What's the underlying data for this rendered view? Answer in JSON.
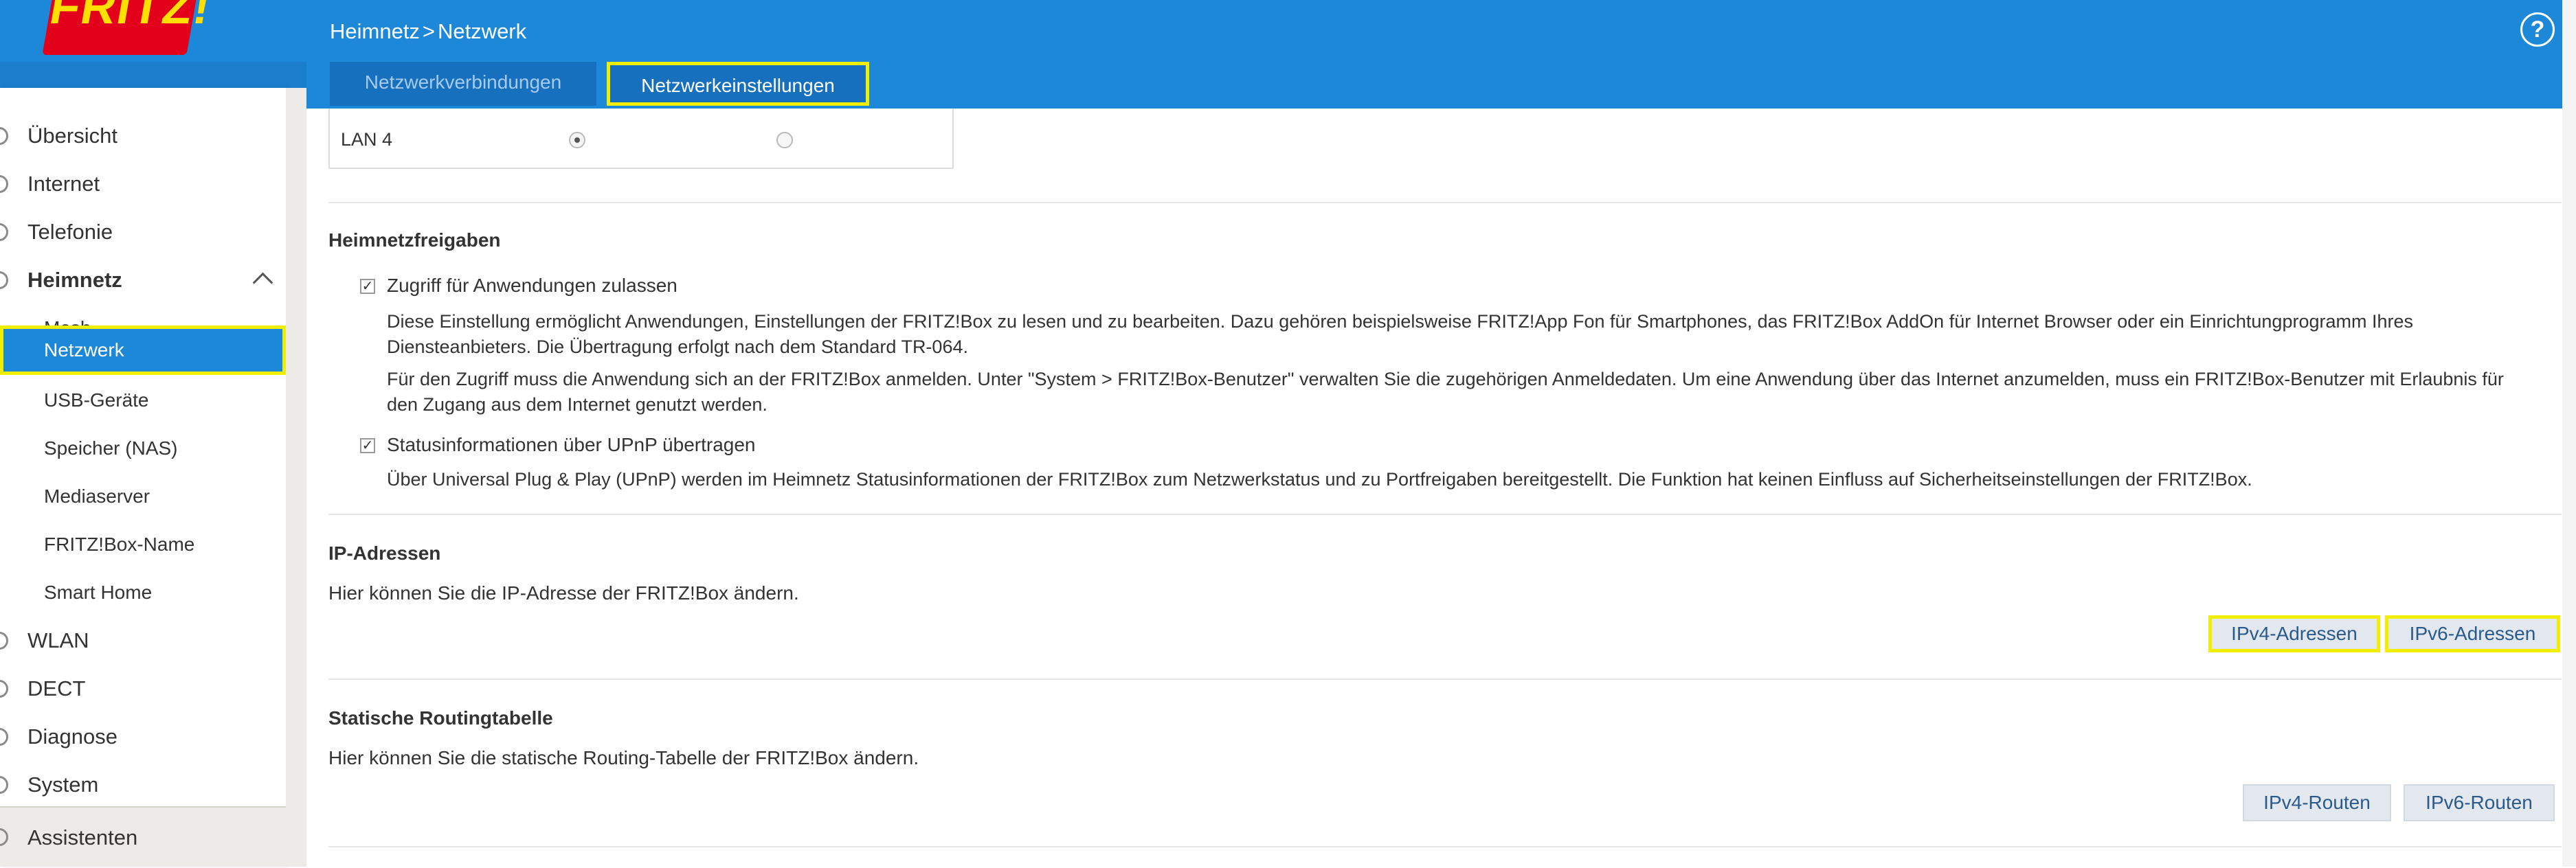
{
  "header": {
    "logo_text": "FRITZ!",
    "breadcrumb": {
      "parent": "Heimnetz",
      "separator": ">",
      "current": "Netzwerk"
    },
    "help_label": "?",
    "tabs": [
      {
        "label": "Netzwerkverbindungen",
        "active": false
      },
      {
        "label": "Netzwerkeinstellungen",
        "active": true
      }
    ]
  },
  "sidebar": {
    "items": [
      {
        "label": "Übersicht",
        "icon": "home-icon"
      },
      {
        "label": "Internet",
        "icon": "globe-icon"
      },
      {
        "label": "Telefonie",
        "icon": "phone-icon"
      },
      {
        "label": "Heimnetz",
        "icon": "network-icon",
        "expanded": true
      },
      {
        "label": "Mesh"
      },
      {
        "label": "Netzwerk",
        "selected": true
      },
      {
        "label": "USB-Geräte"
      },
      {
        "label": "Speicher (NAS)"
      },
      {
        "label": "Mediaserver"
      },
      {
        "label": "FRITZ!Box-Name"
      },
      {
        "label": "Smart Home"
      },
      {
        "label": "WLAN",
        "icon": "wifi-icon"
      },
      {
        "label": "DECT",
        "icon": "dect-icon"
      },
      {
        "label": "Diagnose",
        "icon": "diagnose-icon"
      },
      {
        "label": "System",
        "icon": "gear-icon"
      }
    ],
    "footer": {
      "label": "Assistenten",
      "icon": "wizard-icon"
    }
  },
  "main": {
    "lan_row": {
      "label": "LAN 4",
      "selected_option": 1
    },
    "heimnetzfreigaben": {
      "title": "Heimnetzfreigaben",
      "options": [
        {
          "label": "Zugriff für Anwendungen zulassen",
          "checked": true,
          "desc1": "Diese Einstellung ermöglicht Anwendungen, Einstellungen der FRITZ!Box zu lesen und zu bearbeiten. Dazu gehören beispielsweise FRITZ!App Fon für Smartphones, das FRITZ!Box AddOn für Internet Browser oder ein Einrichtungprogramm Ihres Diensteanbieters. Die Übertragung erfolgt nach dem Standard TR-064.",
          "desc2": "Für den Zugriff muss die Anwendung sich an der FRITZ!Box anmelden. Unter \"System > FRITZ!Box-Benutzer\" verwalten Sie die zugehörigen Anmeldedaten. Um eine Anwendung über das Internet anzumelden, muss ein FRITZ!Box-Benutzer mit Erlaubnis für den Zugang aus dem Internet genutzt werden."
        },
        {
          "label": "Statusinformationen über UPnP übertragen",
          "checked": true,
          "desc1": "Über Universal Plug & Play (UPnP) werden im Heimnetz Statusinformationen der FRITZ!Box zum Netzwerkstatus und zu Portfreigaben bereitgestellt. Die Funktion hat keinen Einfluss auf Sicherheitseinstellungen der FRITZ!Box."
        }
      ]
    },
    "ip_adressen": {
      "title": "IP-Adressen",
      "text": "Hier können Sie die IP-Adresse der FRITZ!Box ändern.",
      "buttons": [
        "IPv4-Adressen",
        "IPv6-Adressen"
      ]
    },
    "routing": {
      "title": "Statische Routingtabelle",
      "text": "Hier können Sie die statische Routing-Tabelle der FRITZ!Box ändern.",
      "buttons": [
        "IPv4-Routen",
        "IPv6-Routen"
      ]
    }
  },
  "colors": {
    "header_blue": "#1e88d8",
    "tab_blue": "#1670be",
    "highlight_yellow": "#f2ee00",
    "button_text": "#2a5a8c"
  }
}
